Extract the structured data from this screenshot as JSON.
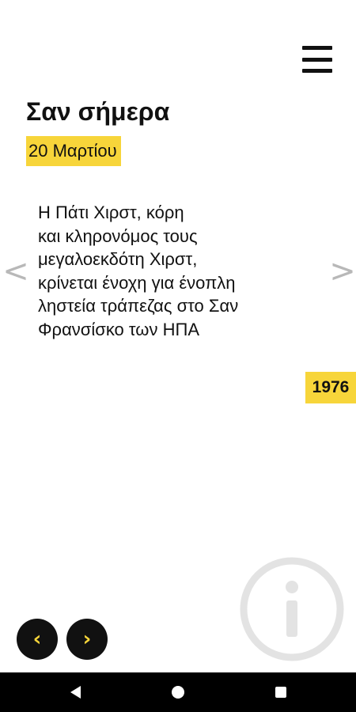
{
  "header": {
    "menu_icon": "hamburger-menu-icon"
  },
  "page": {
    "title": "Σαν σήμερα",
    "date": "20 Μαρτίου"
  },
  "event": {
    "text": "Η Πάτι Χιρστ, κόρη\nκαι κληρονόμος τους\nμεγαλοεκδότη Χιρστ,\nκρίνεται ένοχη για ένοπλη\nληστεία τράπεζας στο Σαν\nΦρανσίσκο των ΗΠΑ",
    "year": "1976"
  },
  "navigation": {
    "prev_arrow": "<",
    "next_arrow": ">",
    "prev_button": "‹",
    "next_button": "›",
    "info_icon": "info-icon"
  },
  "system_nav": {
    "back_icon": "back-triangle-icon",
    "home_icon": "home-circle-icon",
    "recents_icon": "recents-square-icon"
  },
  "colors": {
    "accent": "#f7d53a",
    "text": "#111111",
    "arrow": "#b8b8b8",
    "info": "#e3e3e3",
    "system_bar": "#000000"
  }
}
